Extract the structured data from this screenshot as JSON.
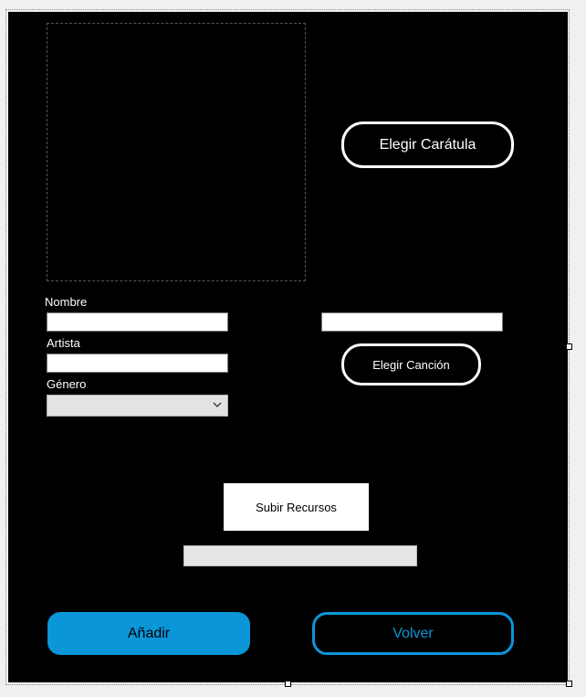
{
  "form": {
    "cover_button_label": "Elegir Carátula",
    "song_button_label": "Elegir Canción",
    "upload_button_label": "Subir Recursos",
    "add_button_label": "Añadir",
    "back_button_label": "Volver"
  },
  "fields": {
    "name_label": "Nombre",
    "name_value": "",
    "artist_label": "Artista",
    "artist_value": "",
    "genre_label": "Género",
    "genre_selected": "",
    "song_path_value": ""
  },
  "upload_progress": 0,
  "colors": {
    "form_background": "#000000",
    "accent": "#0b96d9",
    "button_outline": "#ffffff"
  },
  "icons": {
    "genre_dropdown": "chevron-down-icon"
  }
}
